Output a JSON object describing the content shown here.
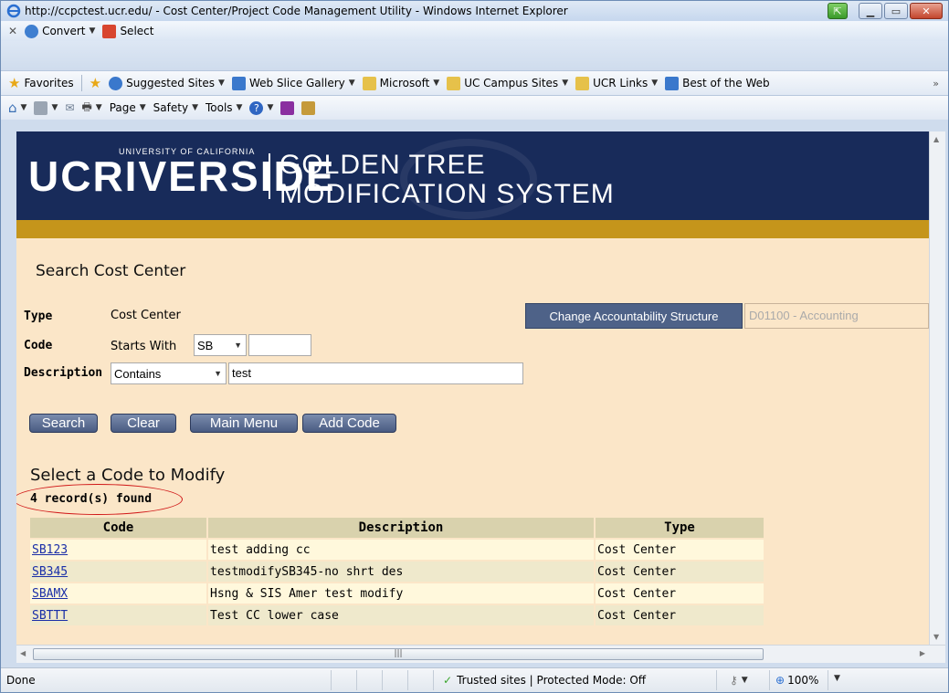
{
  "window": {
    "title": "http://ccpctest.ucr.edu/ - Cost Center/Project Code Management Utility - Windows Internet Explorer"
  },
  "toolbar1": {
    "convert_label": "Convert",
    "select_label": "Select"
  },
  "favorites_bar": {
    "favorites_label": "Favorites",
    "items": [
      "Suggested Sites",
      "Web Slice Gallery",
      "Microsoft",
      "UC Campus Sites",
      "UCR Links",
      "Best of the Web"
    ],
    "overflow": "»"
  },
  "command_bar": {
    "page_label": "Page",
    "safety_label": "Safety",
    "tools_label": "Tools"
  },
  "banner": {
    "ucr_text": "UCRIVERSIDE",
    "university_text": "UNIVERSITY OF CALIFORNIA",
    "system_line1": "GOLDEN TREE",
    "system_line2": "MODIFICATION SYSTEM"
  },
  "search": {
    "heading": "Search Cost Center",
    "type_label": "Type",
    "type_value": "Cost Center",
    "code_label": "Code",
    "code_prefix": "Starts With",
    "code_select": "SB",
    "code_input": "",
    "description_label": "Description",
    "description_select": "Contains",
    "description_input": "test",
    "change_structure_button": "Change Accountability Structure",
    "structure_value": "D01100 - Accounting",
    "buttons": {
      "search": "Search",
      "clear": "Clear",
      "main_menu": "Main Menu",
      "add_code": "Add Code"
    }
  },
  "results": {
    "heading": "Select a Code to Modify",
    "count_text": "4 record(s) found",
    "columns": [
      "Code",
      "Description",
      "Type"
    ],
    "rows": [
      {
        "code": "SB123",
        "description": "test adding cc",
        "type": "Cost Center"
      },
      {
        "code": "SB345",
        "description": "testmodifySB345-no shrt des",
        "type": "Cost Center"
      },
      {
        "code": "SBAMX",
        "description": "Hsng & SIS Amer test modify",
        "type": "Cost Center"
      },
      {
        "code": "SBTTT",
        "description": "Test CC lower case",
        "type": "Cost Center"
      }
    ]
  },
  "statusbar": {
    "status": "Done",
    "zone": "Trusted sites | Protected Mode: Off",
    "zoom": "100%"
  }
}
